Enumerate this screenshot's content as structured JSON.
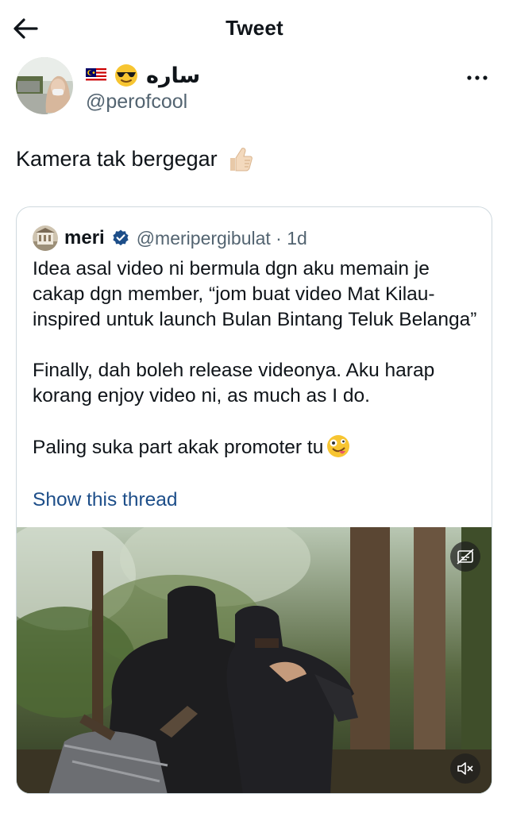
{
  "header": {
    "title": "Tweet",
    "back_icon": "arrow-left-icon"
  },
  "author": {
    "display_name": "ساره",
    "handle": "@perofcool",
    "flag_icon": "malaysia-flag-icon",
    "emoji_icon": "sunglasses-face-icon",
    "more_icon": "more-horizontal-icon"
  },
  "tweet": {
    "text": "Kamera tak bergegar",
    "emoji_icon": "thumbs-up-icon"
  },
  "quoted": {
    "name": "meri",
    "verified_icon": "verified-badge-icon",
    "meta": "@meripergibulat · 1d",
    "paragraphs": [
      "Idea asal video ni bermula dgn aku memain je cakap dgn member, “jom buat video Mat Kilau-inspired untuk launch Bulan Bintang Teluk Belanga”",
      "Finally, dah boleh release videonya. Aku harap korang enjoy video ni, as much as I do.",
      "Paling suka part akak promoter tu"
    ],
    "last_emoji_icon": "zany-face-icon",
    "show_thread": "Show this thread"
  },
  "media": {
    "caption_icon": "captions-off-icon",
    "mute_icon": "volume-muted-icon"
  },
  "colors": {
    "link": "#1d4e89",
    "secondary": "#536471",
    "verified": "#1d4e89",
    "border": "#cfd9de"
  }
}
